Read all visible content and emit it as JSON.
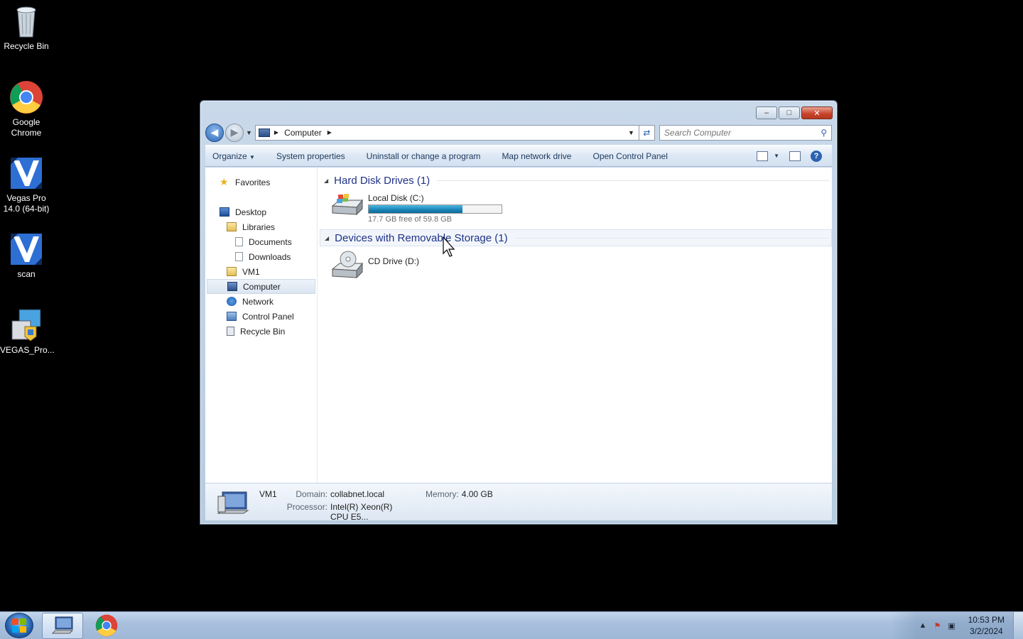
{
  "desktop": {
    "icons": [
      {
        "label": "Recycle Bin",
        "icon": "recycle-bin-icon"
      },
      {
        "label": "Google Chrome",
        "icon": "chrome-icon"
      },
      {
        "label": "Vegas Pro 14.0 (64-bit)",
        "icon": "vegas-pro-icon"
      },
      {
        "label": "scan",
        "icon": "vegas-pro-icon"
      },
      {
        "label": "VEGAS_Pro...",
        "icon": "installer-icon"
      }
    ]
  },
  "window": {
    "caption_buttons": {
      "minimize": "–",
      "maximize": "□",
      "close": "✕"
    },
    "address": {
      "crumb": "Computer"
    },
    "search": {
      "placeholder": "Search Computer"
    },
    "toolbar": {
      "organize": "Organize",
      "system_properties": "System properties",
      "uninstall": "Uninstall or change a program",
      "map_drive": "Map network drive",
      "control_panel": "Open Control Panel"
    },
    "nav": {
      "favorites": "Favorites",
      "desktop": "Desktop",
      "libraries": "Libraries",
      "documents": "Documents",
      "downloads": "Downloads",
      "user": "VM1",
      "computer": "Computer",
      "network": "Network",
      "control_panel": "Control Panel",
      "recycle_bin": "Recycle Bin"
    },
    "groups": {
      "hdd": {
        "title": "Hard Disk Drives (1)"
      },
      "removable": {
        "title": "Devices with Removable Storage (1)"
      }
    },
    "drives": {
      "local": {
        "name": "Local Disk (C:)",
        "free_text": "17.7 GB free of 59.8 GB",
        "used_fraction": 0.704
      },
      "cd": {
        "name": "CD Drive (D:)"
      }
    },
    "details": {
      "name": "VM1",
      "domain_label": "Domain:",
      "domain": "collabnet.local",
      "memory_label": "Memory:",
      "memory": "4.00 GB",
      "processor_label": "Processor:",
      "processor": "Intel(R) Xeon(R) CPU E5..."
    }
  },
  "taskbar": {
    "clock_time": "10:53 PM",
    "clock_date": "3/2/2024"
  },
  "colors": {
    "accent": "#1e3287",
    "bar_fill": "#1883b5",
    "close_button": "#c7402a"
  }
}
